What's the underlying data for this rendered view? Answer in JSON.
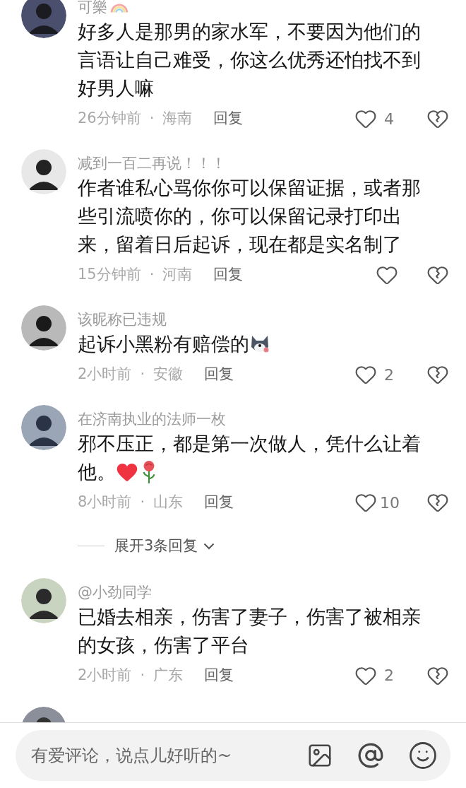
{
  "comments": [
    {
      "name": "可樂",
      "name_icons": [
        {
          "kind": "rainbow"
        }
      ],
      "lines": [
        "好多人是那男的家水军，不要因为他们的",
        "言语让自己难受，你这么优秀还怕找不到",
        "好男人嘛"
      ],
      "time": "26分钟前",
      "separator": "·",
      "region": "海南",
      "reply": "回复",
      "likes": "4"
    },
    {
      "name": "减到一百二再说！！！",
      "lines": [
        "作者谁私心骂你你可以保留证据，或者那",
        "些引流喷你的，你可以保留记录打印出",
        "来，留着日后起诉，现在都是实名制了"
      ],
      "time": "15分钟前",
      "separator": "·",
      "region": "河南",
      "reply": "回复"
    },
    {
      "name": "该昵称已违规",
      "lines": [
        "起诉小黑粉有赔偿的"
      ],
      "emojis": [
        {
          "kind": "dog"
        }
      ],
      "time": "2小时前",
      "separator": "·",
      "region": "安徽",
      "reply": "回复",
      "likes": "2"
    },
    {
      "name": "在济南执业的法师一枚",
      "lines": [
        "邪不压正，都是第一次做人，凭什么让着",
        "他。"
      ],
      "emojis": [
        {
          "kind": "heart"
        },
        {
          "kind": "rose"
        }
      ],
      "time": "8小时前",
      "separator": "·",
      "region": "山东",
      "reply": "回复",
      "likes": "10",
      "replies_toggle": "展开3条回复"
    },
    {
      "name": "@小劲同学",
      "lines": [
        "已婚去相亲，伤害了妻子，伤害了被相亲",
        "的女孩，伤害了平台"
      ],
      "time": "2小时前",
      "separator": "·",
      "region": "广东",
      "reply": "回复",
      "likes": "2"
    }
  ],
  "more_below": true,
  "composer": {
    "placeholder": "有爱评论，说点儿好听的~"
  }
}
